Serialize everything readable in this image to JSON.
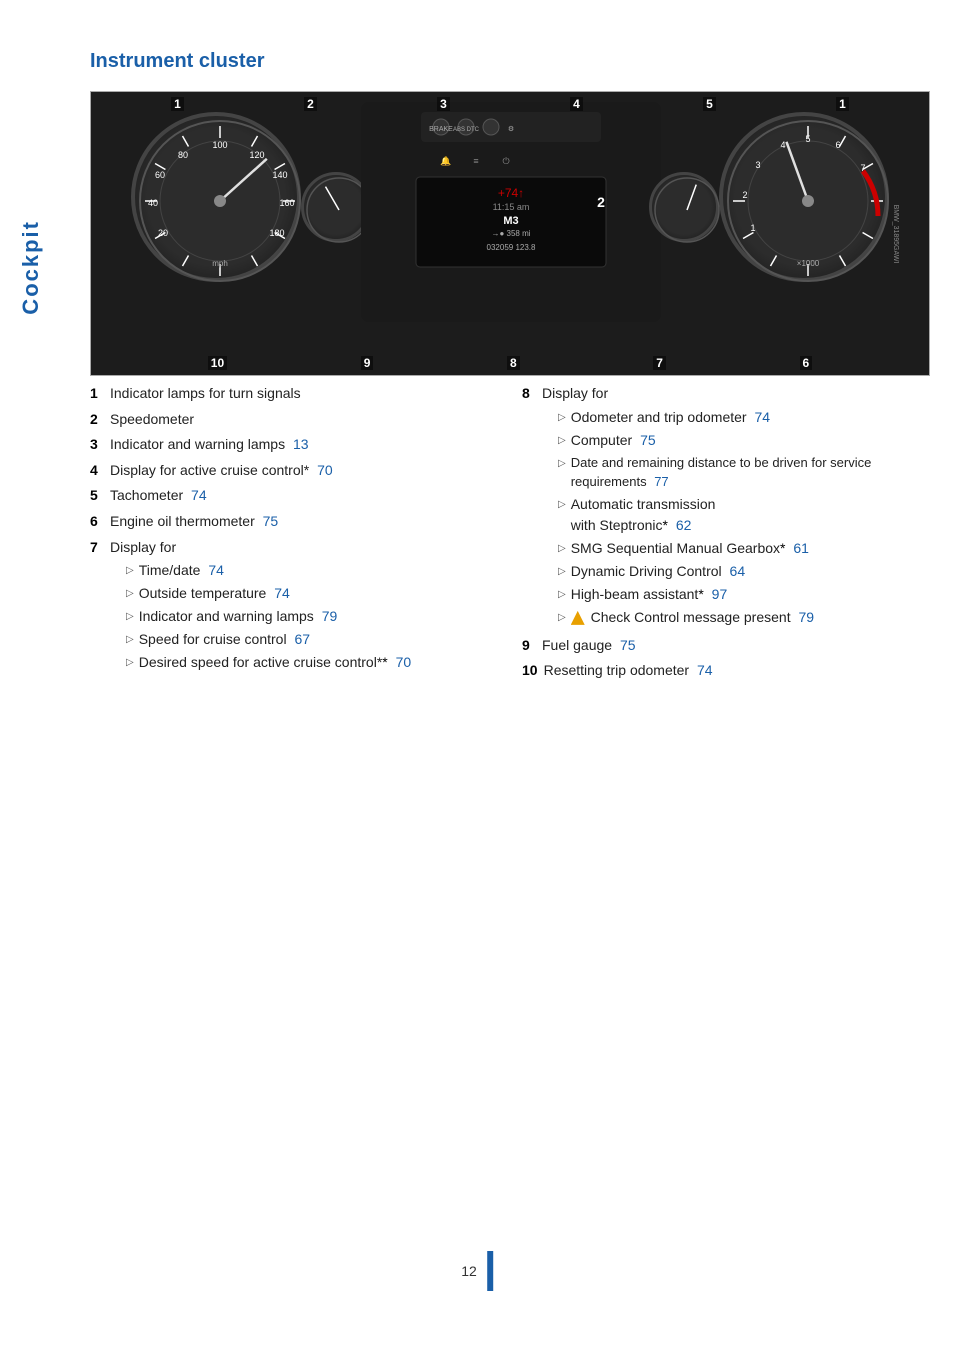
{
  "sidebar": {
    "label": "Cockpit"
  },
  "section": {
    "title": "Instrument cluster"
  },
  "image": {
    "alt": "Instrument cluster diagram",
    "watermark": "BMW_31895GAWI",
    "callouts_top": [
      "1",
      "2",
      "3",
      "4",
      "5",
      "1"
    ],
    "callouts_bottom": [
      "10",
      "9",
      "8",
      "7",
      "6"
    ]
  },
  "left_column": {
    "items": [
      {
        "num": "1",
        "text": "Indicator lamps for turn signals",
        "page": null
      },
      {
        "num": "2",
        "text": "Speedometer",
        "page": null
      },
      {
        "num": "3",
        "text": "Indicator and warning lamps",
        "page": "13"
      },
      {
        "num": "4",
        "text": "Display for active cruise control*",
        "page": "70"
      },
      {
        "num": "5",
        "text": "Tachometer",
        "page": "74"
      },
      {
        "num": "6",
        "text": "Engine oil thermometer",
        "page": "75"
      },
      {
        "num": "7",
        "text": "Display for",
        "page": null
      }
    ],
    "sub_items_7": [
      {
        "text": "Time/date",
        "page": "74"
      },
      {
        "text": "Outside temperature",
        "page": "74"
      },
      {
        "text": "Indicator and warning lamps",
        "page": "79"
      },
      {
        "text": "Speed for cruise control",
        "page": "67"
      },
      {
        "text": "Desired speed for active cruise control*",
        "page": "70"
      }
    ]
  },
  "right_column": {
    "item_8": {
      "num": "8",
      "text": "Display for",
      "page": null
    },
    "sub_items_8": [
      {
        "text": "Odometer and trip odometer",
        "page": "74"
      },
      {
        "text": "Computer",
        "page": "75"
      },
      {
        "text": "Date and remaining distance to be driven for service requirements",
        "page": "77"
      },
      {
        "text": "Automatic transmission with Steptronic*",
        "page": "62"
      },
      {
        "text": "SMG Sequential Manual Gearbox*",
        "page": "61"
      },
      {
        "text": "Dynamic Driving Control",
        "page": "64"
      },
      {
        "text": "High-beam assistant*",
        "page": "97"
      },
      {
        "text": "Check Control message present",
        "page": "79",
        "has_warning": true
      }
    ],
    "items_9_10": [
      {
        "num": "9",
        "text": "Fuel gauge",
        "page": "75"
      },
      {
        "num": "10",
        "text": "Resetting trip odometer",
        "page": "74"
      }
    ]
  },
  "footer": {
    "page_num": "12"
  }
}
